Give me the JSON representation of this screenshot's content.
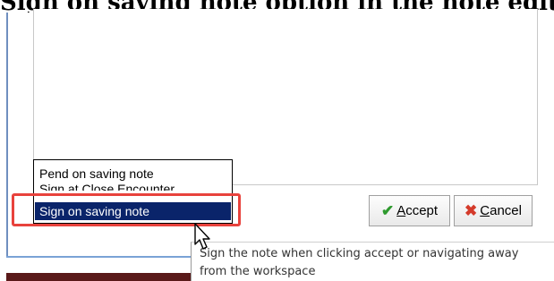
{
  "header": {
    "title": "Sign on saving note option in the note editor"
  },
  "sign_menu": {
    "items": [
      {
        "label": "Pend on saving note",
        "selected": false
      },
      {
        "label": "Sign at Close Encounter",
        "selected": false
      },
      {
        "label": "Sign on saving note",
        "selected": true
      }
    ]
  },
  "buttons": {
    "accept": {
      "icon": "check-icon",
      "accel": "A",
      "rest": "ccept"
    },
    "cancel": {
      "icon": "x-icon",
      "accel": "C",
      "rest": "ancel"
    }
  },
  "tooltip": {
    "line1": "Sign the note when clicking accept or navigating away",
    "line2": "from the workspace"
  },
  "colors": {
    "highlight": "#e8423c",
    "selection": "#0a246a",
    "accept_icon": "#2e9a2e",
    "cancel_icon": "#d43a2a"
  }
}
